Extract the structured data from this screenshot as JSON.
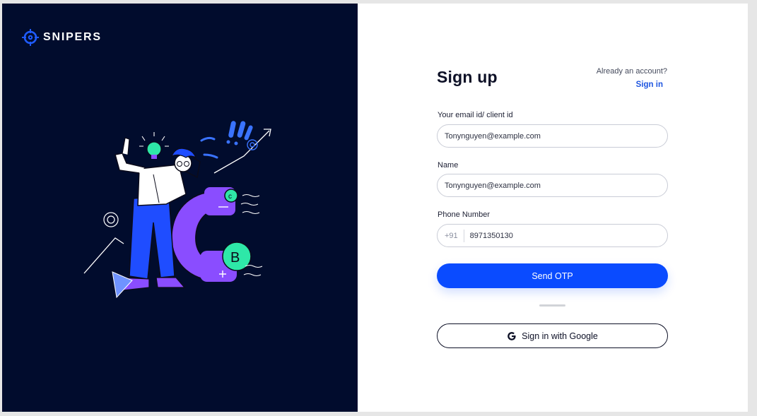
{
  "brand": {
    "name": "SNIPERS",
    "logo_icon": "crosshair-icon",
    "colors": {
      "logo": "#1f5bff",
      "panel_bg": "#010c2d"
    }
  },
  "illustration": {
    "icon": "person-thinking-with-bitcoin-illustration"
  },
  "form": {
    "title": "Sign up",
    "already_text": "Already an account?",
    "signin_label": "Sign in",
    "email": {
      "label": "Your email id/ client id",
      "value": "Tonynguyen@example.com"
    },
    "name": {
      "label": "Name",
      "value": "Tonynguyen@example.com"
    },
    "phone": {
      "label": "Phone Number",
      "prefix": "+91",
      "value": "8971350130"
    },
    "send_otp_label": "Send OTP",
    "google_label": "Sign in with Google",
    "google_icon": "google-g-icon",
    "colors": {
      "accent": "#0a4bff",
      "link": "#1f56e0",
      "text": "#0d1026"
    }
  }
}
